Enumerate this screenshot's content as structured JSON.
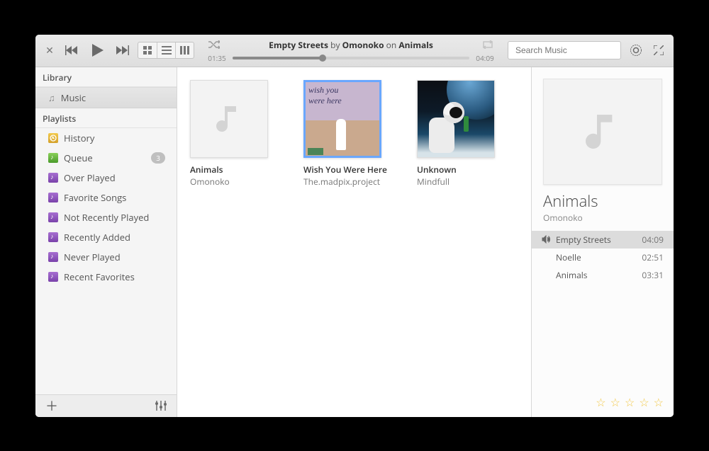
{
  "toolbar": {
    "shuffle_icon": "shuffle",
    "repeat_icon": "repeat",
    "now_playing": {
      "track": "Empty Streets",
      "by": "by",
      "artist": "Omonoko",
      "on": "on",
      "album": "Animals"
    },
    "elapsed": "01:35",
    "duration": "04:09",
    "search_placeholder": "Search Music"
  },
  "sidebar": {
    "library_header": "Library",
    "library_items": [
      {
        "label": "Music",
        "icon": "music",
        "selected": true
      }
    ],
    "playlists_header": "Playlists",
    "playlists": [
      {
        "label": "History",
        "icon": "history"
      },
      {
        "label": "Queue",
        "icon": "queue",
        "badge": "3"
      },
      {
        "label": "Over Played",
        "icon": "pl"
      },
      {
        "label": "Favorite Songs",
        "icon": "pl"
      },
      {
        "label": "Not Recently Played",
        "icon": "pl"
      },
      {
        "label": "Recently Added",
        "icon": "pl"
      },
      {
        "label": "Never Played",
        "icon": "pl"
      },
      {
        "label": "Recent Favorites",
        "icon": "pl"
      }
    ]
  },
  "albums": [
    {
      "title": "Animals",
      "artist": "Omonoko",
      "cover": "placeholder",
      "selected": false
    },
    {
      "title": "Wish You Were Here",
      "artist": "The.madpix.project",
      "cover": "wish",
      "selected": true
    },
    {
      "title": "Unknown",
      "artist": "Mindfull",
      "cover": "astro",
      "selected": false
    }
  ],
  "right": {
    "album": "Animals",
    "artist": "Omonoko",
    "tracks": [
      {
        "title": "Empty Streets",
        "duration": "04:09",
        "playing": true
      },
      {
        "title": "Noelle",
        "duration": "02:51",
        "playing": false
      },
      {
        "title": "Animals",
        "duration": "03:31",
        "playing": false
      }
    ],
    "rating": 0
  }
}
